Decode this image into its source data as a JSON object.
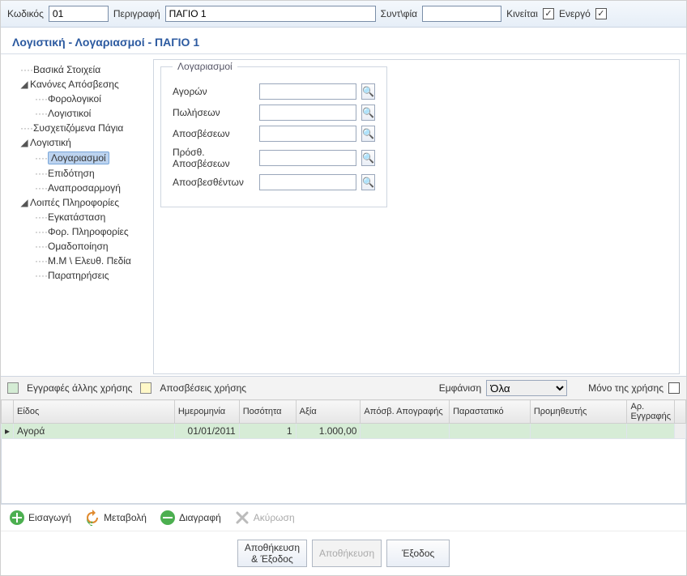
{
  "topbar": {
    "code_label": "Κωδικός",
    "code_value": "01",
    "desc_label": "Περιγραφή",
    "desc_value": "ΠΑΓΙΟ 1",
    "abbr_label": "Συντ\\φία",
    "abbr_value": "",
    "moves_label": "Κινείται",
    "active_label": "Ενεργό"
  },
  "breadcrumb": "Λογιστική - Λογαριασμοί - ΠΑΓΙΟ 1",
  "tree": {
    "n0": "Βασικά Στοιχεία",
    "n1": "Κανόνες Απόσβεσης",
    "n1a": "Φορολογικοί",
    "n1b": "Λογιστικοί",
    "n2": "Συσχετιζόμενα Πάγια",
    "n3": "Λογιστική",
    "n3a": "Λογαριασμοί",
    "n3b": "Επιδότηση",
    "n3c": "Αναπροσαρμογή",
    "n4": "Λοιπές Πληροφορίες",
    "n4a": "Εγκατάσταση",
    "n4b": "Φορ. Πληροφορίες",
    "n4c": "Ομαδοποίηση",
    "n4d": "Μ.Μ \\ Ελευθ. Πεδία",
    "n4e": "Παρατηρήσεις"
  },
  "accounts_panel": {
    "legend": "Λογαριασμοί",
    "rows": {
      "purchases": "Αγορών",
      "sales": "Πωλήσεων",
      "depr": "Αποσβέσεων",
      "extra_depr": "Πρόσθ. Αποσβέσεων",
      "accum_depr": "Αποσβεσθέντων"
    }
  },
  "legendbar": {
    "other_year": "Εγγραφές άλλης χρήσης",
    "year_depr": "Αποσβέσεις χρήσης",
    "view_label": "Εμφάνιση",
    "view_value": "Όλα",
    "only_year": "Μόνο της χρήσης"
  },
  "grid": {
    "headers": {
      "type": "Είδος",
      "date": "Ημερομηνία",
      "qty": "Ποσότητα",
      "value": "Αξία",
      "inv_depr": "Απόσβ. Απογραφής",
      "doc": "Παραστατικό",
      "supplier": "Προμηθευτής",
      "entry_no": "Αρ. Εγγραφής"
    },
    "row0": {
      "type": "Αγορά",
      "date": "01/01/2011",
      "qty": "1",
      "value": "1.000,00",
      "inv_depr": "",
      "doc": "",
      "supplier": "",
      "entry_no": ""
    }
  },
  "toolbar": {
    "insert": "Εισαγωγή",
    "edit": "Μεταβολή",
    "delete": "Διαγραφή",
    "cancel": "Ακύρωση"
  },
  "footer": {
    "save_exit": "Αποθήκευση\n& Έξοδος",
    "save": "Αποθήκευση",
    "exit": "Έξοδος"
  }
}
